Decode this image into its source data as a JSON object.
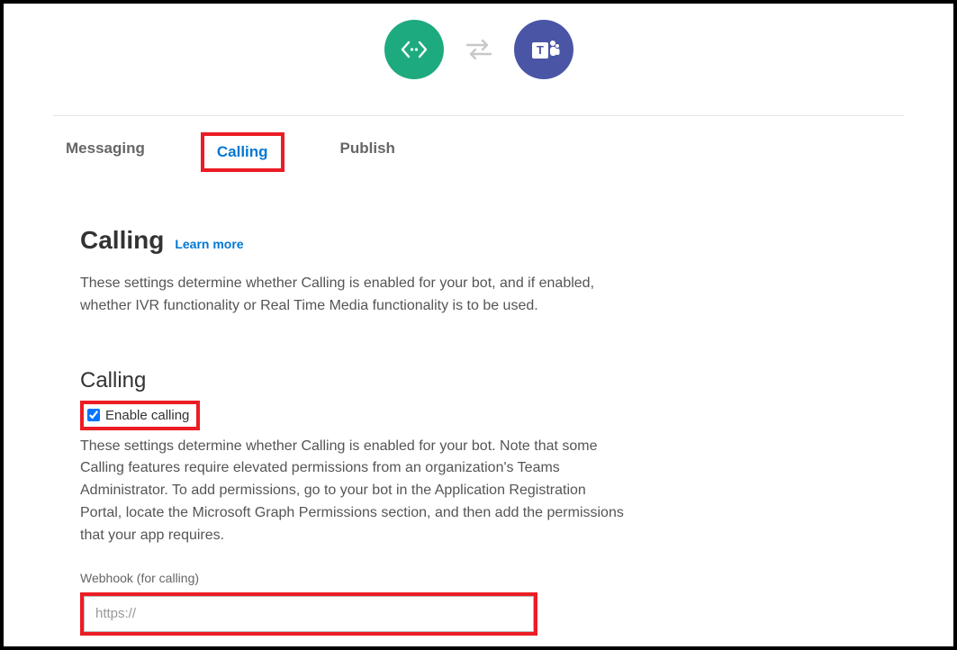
{
  "tabs": {
    "messaging": "Messaging",
    "calling": "Calling",
    "publish": "Publish"
  },
  "section": {
    "title": "Calling",
    "learn_more": "Learn more",
    "description": "These settings determine whether Calling is enabled for your bot, and if enabled, whether IVR functionality or Real Time Media functionality is to be used."
  },
  "calling_block": {
    "heading": "Calling",
    "checkbox_label": "Enable calling",
    "checkbox_checked": true,
    "description": "These settings determine whether Calling is enabled for your bot. Note that some Calling features require elevated permissions from an organization's Teams Administrator. To add permissions, go to your bot in the Application Registration Portal, locate the Microsoft Graph Permissions section, and then add the permissions that your app requires.",
    "webhook_label": "Webhook (for calling)",
    "webhook_placeholder": "https://",
    "webhook_value": ""
  },
  "icons": {
    "bot": "bot-code-icon",
    "swap": "swap-arrows-icon",
    "teams": "teams-icon"
  },
  "colors": {
    "accent": "#0078d4",
    "bot_bg": "#1eaa7f",
    "teams_bg": "#4a55a6",
    "highlight": "#ec1c24"
  }
}
